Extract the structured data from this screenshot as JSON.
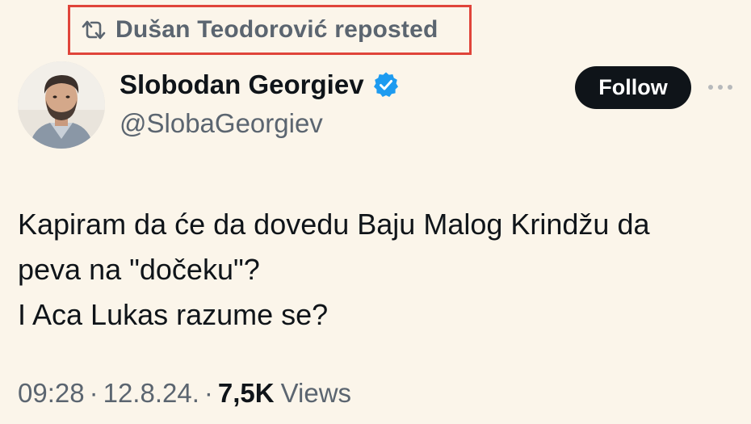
{
  "repost": {
    "icon": "repost-icon",
    "text": "Dušan Teodorović reposted",
    "highlight_color": "#e0443a"
  },
  "author": {
    "name": "Slobodan Georgiev",
    "handle": "@SlobaGeorgiev",
    "verified": true,
    "verified_color": "#1d9bf0",
    "avatar_icon": "avatar"
  },
  "actions": {
    "follow_label": "Follow",
    "more_icon": "more-icon"
  },
  "tweet": {
    "lines": [
      "Kapiram da će da dovedu Baju Malog Krindžu da",
      "peva na \"dočeku\"?",
      "I Aca Lukas razume se?"
    ]
  },
  "meta": {
    "time": "09:28",
    "separator": "·",
    "date": "12.8.24.",
    "views_count": "7,5K",
    "views_label": "Views"
  },
  "colors": {
    "background": "#fbf5ea",
    "primary_text": "#0f1419",
    "secondary_text": "#5b6570"
  }
}
